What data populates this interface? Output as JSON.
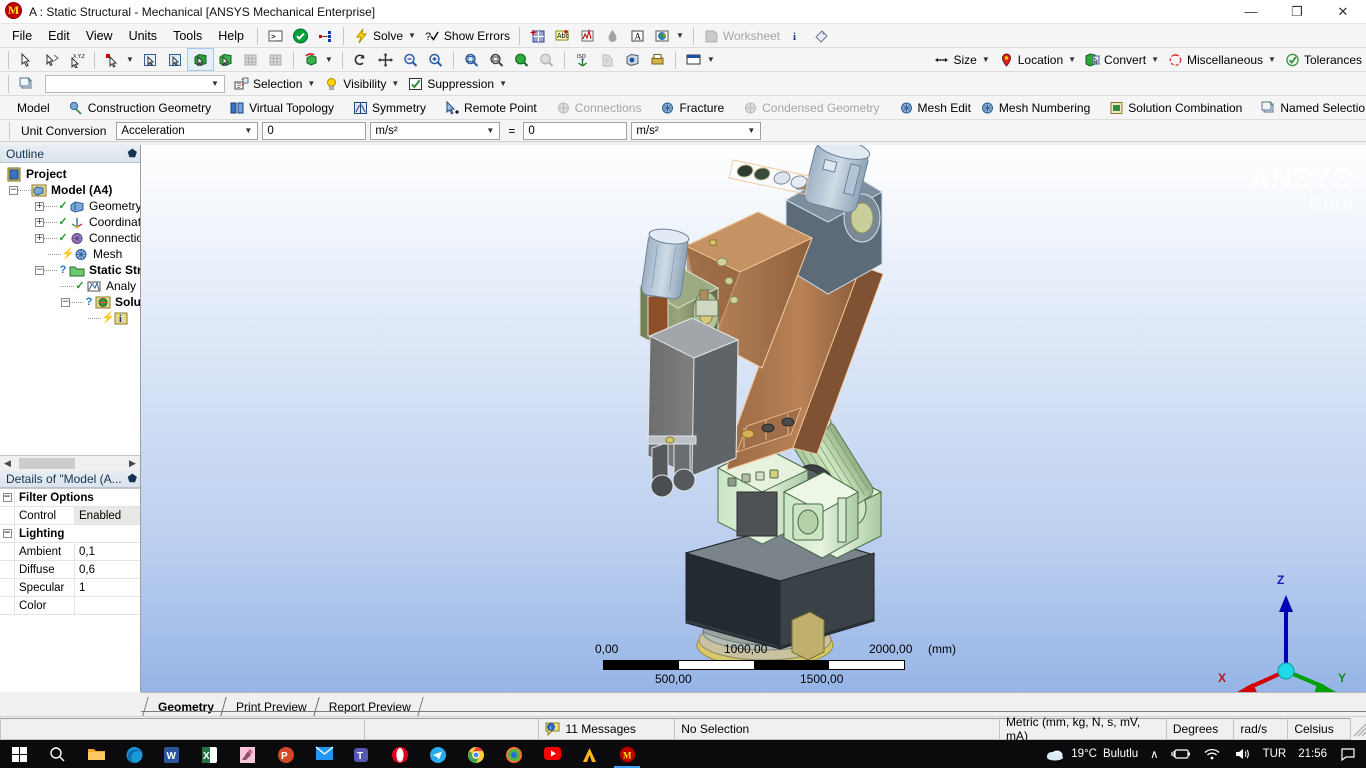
{
  "window": {
    "title": "A : Static Structural - Mechanical [ANSYS Mechanical Enterprise]",
    "app_badge": "M",
    "minimize": "—",
    "maximize": "❐",
    "close": "✕"
  },
  "menu": {
    "items": [
      "File",
      "Edit",
      "View",
      "Units",
      "Tools",
      "Help"
    ]
  },
  "toolbar_main": {
    "items": [
      {
        "label": "",
        "icon": "console-icon",
        "name": "console-button",
        "enabled": true
      },
      {
        "label": "",
        "icon": "green-check-icon",
        "name": "validate-button",
        "enabled": true
      },
      {
        "label": "",
        "icon": "connect-dots-icon",
        "name": "connections-button",
        "enabled": true
      },
      {
        "label": "Solve",
        "icon": "lightning-icon",
        "name": "solve-button",
        "enabled": true,
        "dropdown": true
      },
      {
        "label": "Show Errors",
        "icon": "question-check-icon",
        "name": "show-errors-button",
        "enabled": true
      },
      {
        "label": "",
        "icon": "new-chart-icon",
        "name": "new-chart-button",
        "enabled": true
      },
      {
        "label": "",
        "icon": "abc-comment-icon",
        "name": "annotation-button",
        "enabled": true
      },
      {
        "label": "",
        "icon": "graph-icon",
        "name": "graph-button",
        "enabled": true
      },
      {
        "label": "",
        "icon": "drop-icon",
        "name": "drop-button",
        "enabled": true
      },
      {
        "label": "",
        "icon": "letter-a-icon",
        "name": "text-annotation-button",
        "enabled": true
      },
      {
        "label": "",
        "icon": "globe-icon",
        "name": "image-button",
        "enabled": true,
        "dropdown": true
      },
      {
        "label": "Worksheet",
        "icon": "worksheet-icon",
        "name": "worksheet-button",
        "enabled": false
      },
      {
        "label": "",
        "icon": "info-i-icon",
        "name": "info-button",
        "enabled": true
      },
      {
        "label": "",
        "icon": "tag-icon",
        "name": "tag-button",
        "enabled": true
      }
    ]
  },
  "toolbar_graphics": {
    "items": [
      {
        "icon": "select-cursor-icon",
        "name": "select-mode-button"
      },
      {
        "icon": "box-select-icon",
        "name": "box-select-button"
      },
      {
        "icon": "xyz-probe-icon",
        "name": "xyz-probe-button"
      },
      {
        "icon": "pick-mode-icon",
        "name": "pick-mode-button",
        "dropdown": true
      },
      {
        "icon": "single-select-icon",
        "name": "single-select-button"
      },
      {
        "icon": "box-volume-select-icon",
        "name": "box-volume-select-button"
      },
      {
        "icon": "body-select-icon",
        "name": "body-select-button",
        "pressed": true
      },
      {
        "icon": "body-select-green-icon",
        "name": "solid-select-button"
      },
      {
        "icon": "mesh-select-icon",
        "name": "mesh-select-button",
        "enabled": false
      },
      {
        "icon": "mesh-node-select-icon",
        "name": "node-select-button",
        "enabled": false
      },
      {
        "icon": "rotate-cube-icon",
        "name": "rotate-view-button",
        "dropdown": true
      },
      {
        "icon": "rotate-arrow-icon",
        "name": "rotate-button"
      },
      {
        "icon": "pan-icon",
        "name": "pan-button"
      },
      {
        "icon": "zoom-out-icon",
        "name": "zoom-out-button"
      },
      {
        "icon": "zoom-in-icon",
        "name": "zoom-in-button"
      },
      {
        "icon": "box-zoom-icon",
        "name": "box-zoom-button"
      },
      {
        "icon": "zoom-to-fit-icon",
        "name": "zoom-to-fit-button"
      },
      {
        "icon": "magnify-green-icon",
        "name": "magnifier-button"
      },
      {
        "icon": "magnify-gray-icon",
        "name": "magnifier-off-button",
        "enabled": false
      },
      {
        "icon": "iso-view-icon",
        "name": "iso-view-button"
      },
      {
        "icon": "set-view-icon",
        "name": "set-view-button",
        "enabled": false
      },
      {
        "icon": "view-cube-icon",
        "name": "view-cube-button"
      },
      {
        "icon": "print-preview-icon",
        "name": "print-preview-button"
      },
      {
        "icon": "display-style-icon",
        "name": "display-style-button",
        "dropdown": true
      }
    ]
  },
  "toolbar_tools": {
    "items": [
      {
        "label": "Size",
        "icon": "size-arrows-icon",
        "name": "size-button",
        "dropdown": true
      },
      {
        "label": "Location",
        "icon": "location-pin-icon",
        "name": "location-button",
        "dropdown": true
      },
      {
        "label": "Convert",
        "icon": "convert-box-icon",
        "name": "convert-button",
        "dropdown": true
      },
      {
        "label": "Miscellaneous",
        "icon": "misc-circle-icon",
        "name": "miscellaneous-button",
        "dropdown": true
      },
      {
        "label": "Tolerances",
        "icon": "tolerance-check-icon",
        "name": "tolerances-button"
      }
    ]
  },
  "toolbar_named": {
    "named_selection_value": "",
    "items": [
      {
        "label": "Selection",
        "icon": "selection-icon",
        "name": "selection-button",
        "dropdown": true
      },
      {
        "label": "Visibility",
        "icon": "bulb-icon",
        "name": "visibility-button",
        "dropdown": true
      },
      {
        "label": "Suppression",
        "icon": "suppression-icon",
        "name": "suppression-button",
        "dropdown": true
      }
    ]
  },
  "toolbar_context": {
    "items": [
      {
        "label": "Model",
        "icon": "",
        "name": "model-button",
        "enabled": true
      },
      {
        "label": "Construction Geometry",
        "icon": "construction-geometry-icon",
        "name": "construction-geometry-button",
        "enabled": true
      },
      {
        "label": "Virtual Topology",
        "icon": "virtual-topology-icon",
        "name": "virtual-topology-button",
        "enabled": true
      },
      {
        "label": "Symmetry",
        "icon": "symmetry-icon",
        "name": "symmetry-button",
        "enabled": true
      },
      {
        "label": "Remote Point",
        "icon": "remote-point-icon",
        "name": "remote-point-button",
        "enabled": true
      },
      {
        "label": "Connections",
        "icon": "connections-icon",
        "name": "connections-button",
        "enabled": false
      },
      {
        "label": "Fracture",
        "icon": "fracture-icon",
        "name": "fracture-button",
        "enabled": true
      },
      {
        "label": "Condensed Geometry",
        "icon": "condensed-geometry-icon",
        "name": "condensed-geometry-button",
        "enabled": false
      },
      {
        "label": "Mesh Edit",
        "icon": "mesh-edit-icon",
        "name": "mesh-edit-button",
        "enabled": true
      },
      {
        "label": "Mesh Numbering",
        "icon": "mesh-numbering-icon",
        "name": "mesh-numbering-button",
        "enabled": true
      },
      {
        "label": "Solution Combination",
        "icon": "solution-combination-icon",
        "name": "solution-combination-button",
        "enabled": true
      },
      {
        "label": "Named Selectio",
        "icon": "named-selection-icon",
        "name": "named-selection-button",
        "enabled": true
      }
    ]
  },
  "unit_conversion": {
    "label": "Unit Conversion",
    "quantity": "Acceleration",
    "input_value": "0",
    "input_unit": "m/s²",
    "equals": "=",
    "output_value": "0",
    "output_unit": "m/s²"
  },
  "outline": {
    "title": "Outline",
    "pin": "⬟",
    "items": [
      {
        "label": "Project",
        "depth": 0,
        "icon": "project-icon",
        "bold": true,
        "expander": "",
        "status": ""
      },
      {
        "label": "Model (A4)",
        "depth": 1,
        "icon": "model-icon",
        "bold": true,
        "expander": "minus",
        "status": ""
      },
      {
        "label": "Geometry",
        "depth": 2,
        "icon": "geometry-icon",
        "bold": false,
        "expander": "plus",
        "status": "check"
      },
      {
        "label": "Coordinate",
        "depth": 2,
        "icon": "coordinate-systems-icon",
        "bold": false,
        "expander": "plus",
        "status": "check"
      },
      {
        "label": "Connection",
        "depth": 2,
        "icon": "connections-tree-icon",
        "bold": false,
        "expander": "plus",
        "status": "check"
      },
      {
        "label": "Mesh",
        "depth": 2,
        "icon": "mesh-tree-icon",
        "bold": false,
        "expander": "",
        "status": "bolt"
      },
      {
        "label": "Static Str",
        "depth": 2,
        "icon": "static-structural-icon",
        "bold": true,
        "expander": "minus",
        "status": "question"
      },
      {
        "label": "Analy",
        "depth": 3,
        "icon": "analysis-settings-icon",
        "bold": false,
        "expander": "",
        "status": "check"
      },
      {
        "label": "Solu",
        "depth": 3,
        "icon": "solution-icon",
        "bold": true,
        "expander": "minus",
        "status": "question"
      },
      {
        "label": "",
        "depth": 4,
        "icon": "solution-information-icon",
        "bold": false,
        "expander": "",
        "status": "bolt"
      }
    ]
  },
  "details": {
    "title": "Details of \"Model (A...",
    "pin": "⬟",
    "rows": [
      {
        "kind": "section",
        "name": "Filter Options",
        "value": "",
        "expander": "minus"
      },
      {
        "kind": "prop",
        "name": "Control",
        "value": "Enabled",
        "highlight": true
      },
      {
        "kind": "section",
        "name": "Lighting",
        "value": "",
        "expander": "minus"
      },
      {
        "kind": "prop",
        "name": "Ambient",
        "value": "0,1",
        "highlight": false
      },
      {
        "kind": "prop",
        "name": "Diffuse",
        "value": "0,6",
        "highlight": false
      },
      {
        "kind": "prop",
        "name": "Specular",
        "value": "1",
        "highlight": false
      },
      {
        "kind": "prop",
        "name": "Color",
        "value": "",
        "highlight": false
      }
    ]
  },
  "viewport": {
    "brand": "ANSYS",
    "release": "R18.0",
    "triad": {
      "x": "X",
      "y": "Y",
      "z": "Z",
      "x_color": "#d40000",
      "y_color": "#00a000",
      "z_color": "#0000b4"
    },
    "scale_bar": {
      "ticks_top": [
        "0,00",
        "1000,00",
        "2000,00"
      ],
      "ticks_bottom": [
        "500,00",
        "1500,00"
      ],
      "unit": "(mm)"
    }
  },
  "view_tabs": {
    "tabs": [
      {
        "label": "Geometry",
        "active": true
      },
      {
        "label": "Print Preview",
        "active": false
      },
      {
        "label": "Report Preview",
        "active": false
      }
    ]
  },
  "status_bar": {
    "cell1": "",
    "cell2": "",
    "messages": "11 Messages",
    "selection": "No Selection",
    "unit_system": "Metric (mm, kg, N, s, mV, mA)",
    "angle": "Degrees",
    "rotation": "rad/s",
    "temperature": "Celsius"
  },
  "taskbar": {
    "items": [
      {
        "name": "start-button",
        "icon": "windows-logo-icon"
      },
      {
        "name": "search-button",
        "icon": "search-icon"
      },
      {
        "name": "file-explorer-button",
        "icon": "folder-icon"
      },
      {
        "name": "edge-button",
        "icon": "edge-icon"
      },
      {
        "name": "word-button",
        "icon": "word-icon"
      },
      {
        "name": "excel-button",
        "icon": "excel-icon"
      },
      {
        "name": "paint-button",
        "icon": "paint-icon"
      },
      {
        "name": "powerpoint-button",
        "icon": "powerpoint-icon"
      },
      {
        "name": "mail-button",
        "icon": "mail-icon"
      },
      {
        "name": "teams-button",
        "icon": "teams-icon"
      },
      {
        "name": "opera-button",
        "icon": "opera-icon"
      },
      {
        "name": "telegram-button",
        "icon": "telegram-icon"
      },
      {
        "name": "chrome-button",
        "icon": "chrome-icon"
      },
      {
        "name": "firefox-button",
        "icon": "firefox-icon"
      },
      {
        "name": "youtube-button",
        "icon": "youtube-icon"
      },
      {
        "name": "ansys-workbench-button",
        "icon": "ansys-icon"
      },
      {
        "name": "mechanical-button",
        "icon": "mechanical-icon",
        "active": true
      }
    ],
    "weather": {
      "temperature": "19°C",
      "condition": "Bulutlu"
    },
    "tray": {
      "chevron": "∧",
      "battery": "battery-icon",
      "wifi": "wifi-icon",
      "volume": "speaker-icon",
      "language": "TUR",
      "clock": "21:56",
      "notifications": "notification-icon"
    }
  }
}
